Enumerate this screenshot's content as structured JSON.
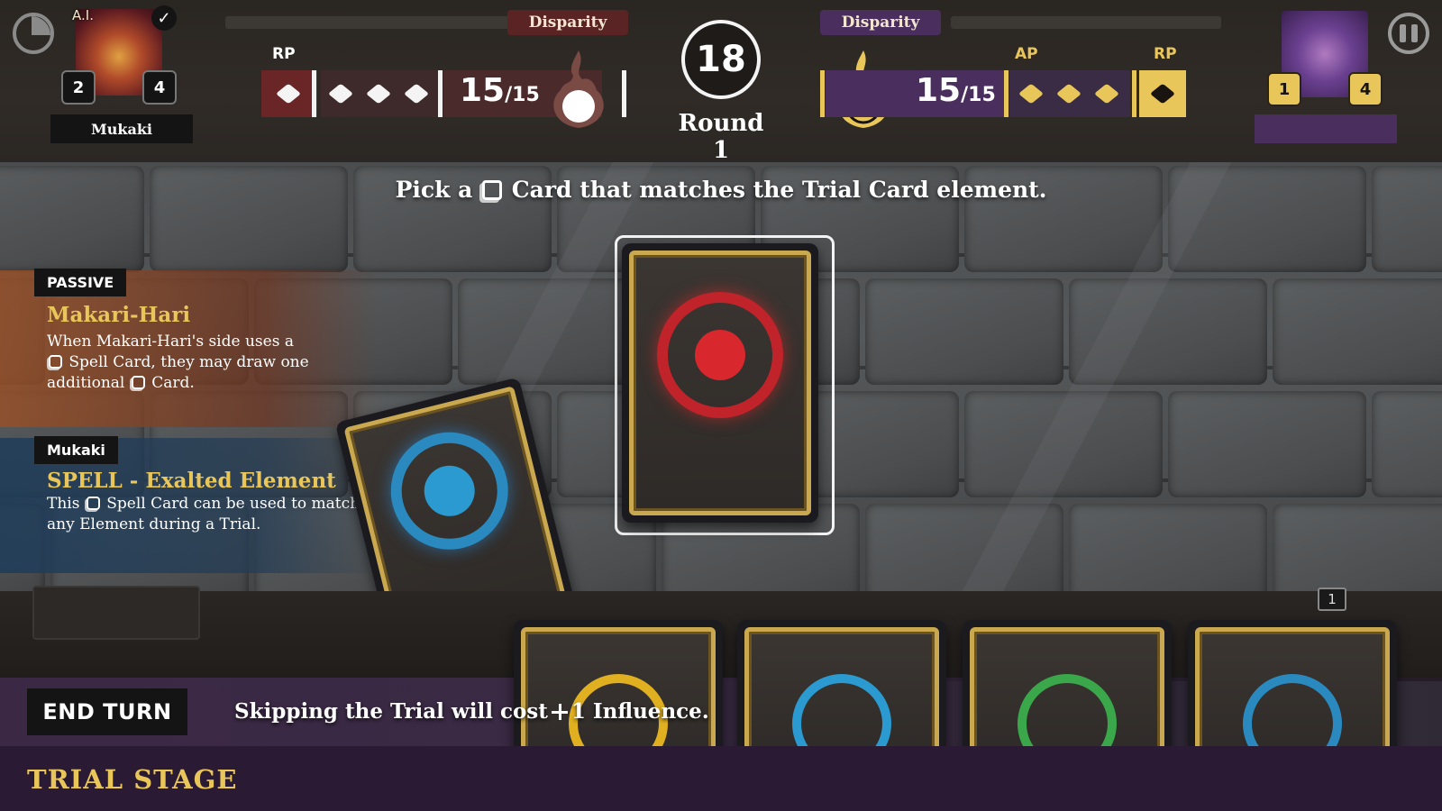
{
  "header": {
    "ai_tag": "A.I.",
    "ai_name": "Mukaki",
    "ai_hand_count": "2",
    "ai_deck_count": "4",
    "player_hand_count": "1",
    "player_deck_count": "4",
    "player_name": "",
    "disparity_left": "Disparity",
    "disparity_right": "Disparity",
    "rp_left_label": "RP",
    "ap_right_label": "AP",
    "rp_right_label": "RP",
    "hp_left": "15",
    "hp_left_max": "/15",
    "hp_right": "15",
    "hp_right_max": "/15",
    "round_number": "18",
    "round_label": "Round 1"
  },
  "instruction": {
    "prefix": "Pick a",
    "suffix": "Card that matches the Trial Card element."
  },
  "passive": {
    "tag": "PASSIVE",
    "title": "Makari-Hari",
    "body_1": "When Makari-Hari's side uses a",
    "body_2": "Spell Card, they may draw one",
    "body_3": "additional",
    "body_4": "Card."
  },
  "spell": {
    "tag": "Mukaki",
    "title": "SPELL - Exalted Element",
    "body_1": "This",
    "body_2": "Spell Card can be used to match",
    "body_3": "any Element during a Trial."
  },
  "bottom": {
    "end_turn": "END TURN",
    "skip_text_1": "Skipping the Trial will cost",
    "skip_text_2": "1 Influence.",
    "stage": "TRIAL STAGE",
    "deck_count": "1"
  },
  "hand_cards": [
    {
      "element": "yellow",
      "color": "#e0b020"
    },
    {
      "element": "blue",
      "color": "#2a9ad0"
    },
    {
      "element": "green",
      "color": "#3aa84a"
    },
    {
      "element": "blue",
      "color": "#2a8ac0"
    }
  ],
  "colors": {
    "gold": "#e8c65a",
    "ai_red": "#6a2626",
    "player_purple": "#4a2e5e",
    "trial_red": "#c0242a",
    "spell_blue": "#2a8ac0"
  }
}
